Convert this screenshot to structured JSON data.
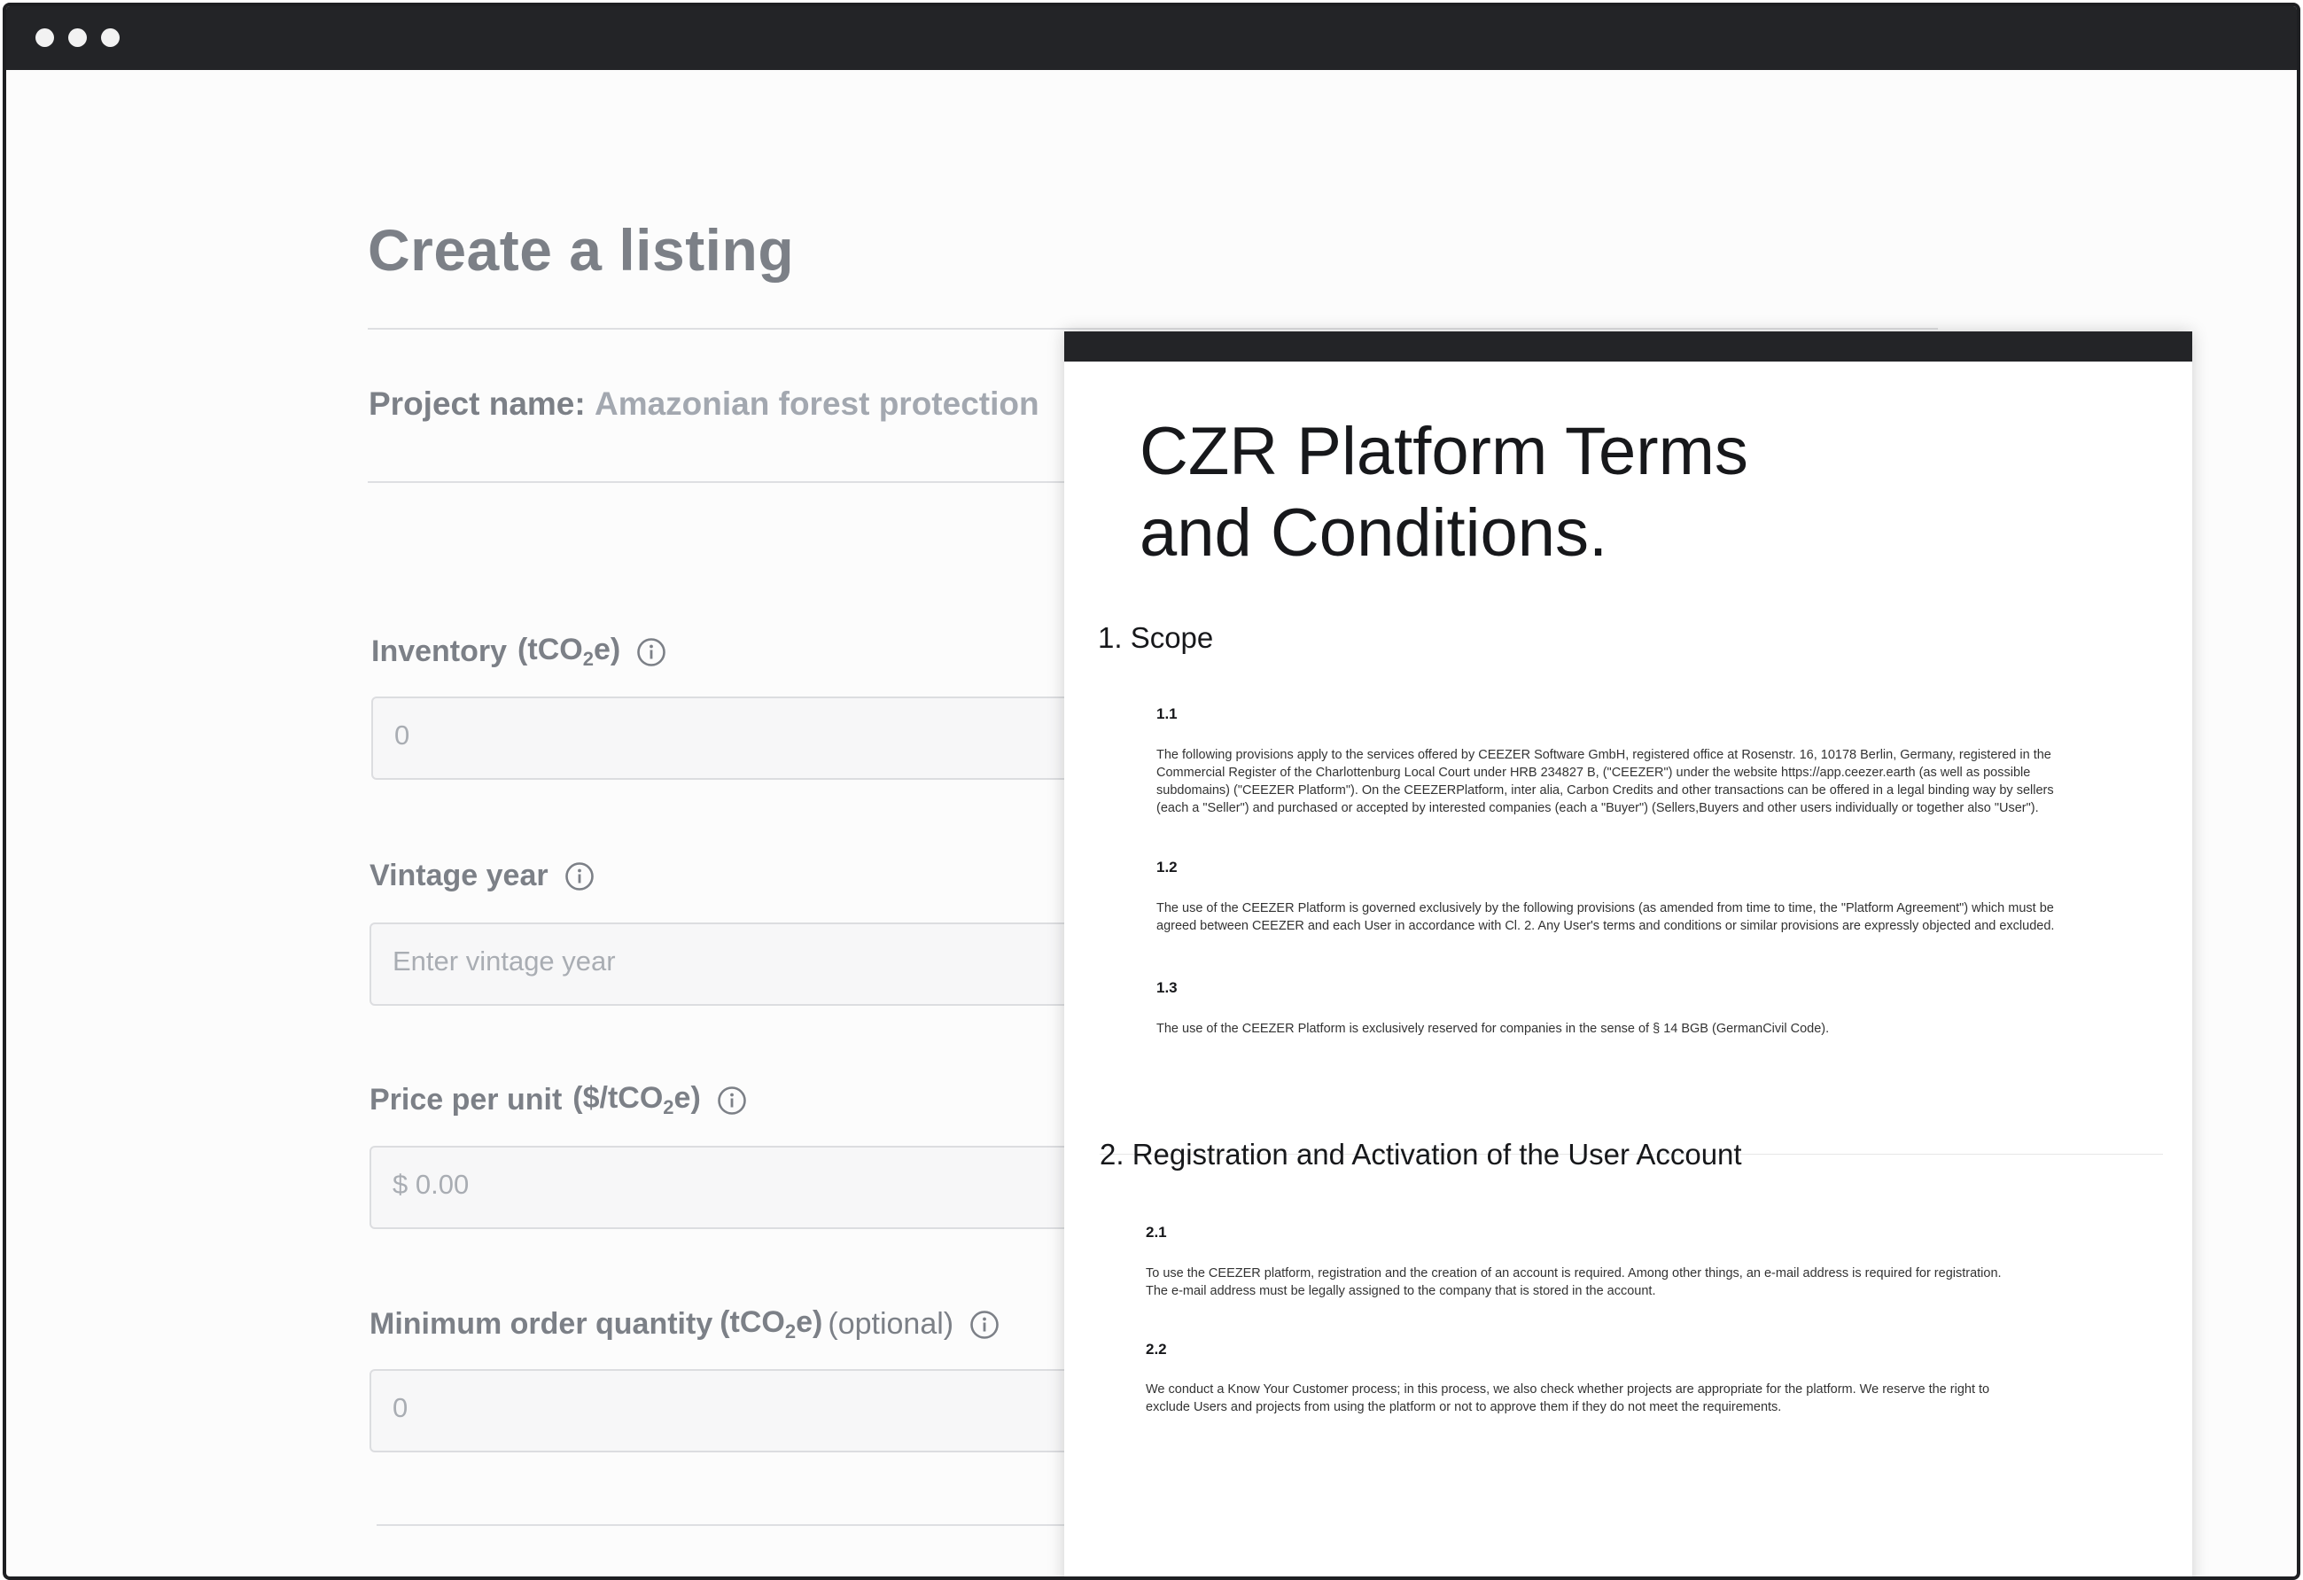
{
  "page": {
    "title": "Create a listing"
  },
  "project": {
    "label": "Project name:",
    "value": "Amazonian forest protection"
  },
  "fields": {
    "inventory": {
      "label": "Inventory",
      "unit_prefix": "(tCO",
      "unit_sub": "2",
      "unit_suffix": "e)",
      "placeholder": "0"
    },
    "vintage_year": {
      "label": "Vintage year",
      "placeholder": "Enter vintage year"
    },
    "price_per_unit": {
      "label": "Price per unit",
      "unit_prefix": "($/tCO",
      "unit_sub": "2",
      "unit_suffix": "e)",
      "placeholder": "$ 0.00"
    },
    "min_order": {
      "label": "Minimum order quantity",
      "unit_prefix": "(tCO",
      "unit_sub": "2",
      "unit_suffix": "e)",
      "optional": "(optional)",
      "placeholder": "0"
    }
  },
  "terms": {
    "title_line1": "CZR Platform Terms",
    "title_line2": "and Conditions.",
    "sections": [
      {
        "heading": "1. Scope",
        "items": [
          {
            "num": "1.1",
            "lines": [
              "The following provisions apply to the services offered by CEEZER Software GmbH, registered office at Rosenstr. 16, 10178 Berlin, Germany, registered in the",
              "Commercial Register of the Charlottenburg Local Court under HRB 234827 B, (\"CEEZER\") under the website https://app.ceezer.earth (as well as possible",
              "subdomains) (\"CEEZER Platform\"). On the CEEZERPlatform, inter alia, Carbon Credits and other transactions can be offered in a legal binding way by sellers",
              "(each a \"Seller\") and purchased or accepted by interested companies (each a \"Buyer\") (Sellers,Buyers and other users individually or together also \"User\")."
            ]
          },
          {
            "num": "1.2",
            "lines": [
              "The use of the CEEZER Platform is governed exclusively by the following provisions (as amended from time to time, the \"Platform Agreement\") which must be",
              "agreed between CEEZER and each User in accordance with Cl. 2. Any User's terms and conditions or similar provisions are expressly objected and excluded."
            ]
          },
          {
            "num": "1.3",
            "lines": [
              "The use of the CEEZER Platform is exclusively reserved for companies in the sense of § 14 BGB (GermanCivil Code)."
            ]
          }
        ]
      },
      {
        "heading": "2. Registration and Activation of the User Account",
        "items": [
          {
            "num": "2.1",
            "lines": [
              "To use the CEEZER platform, registration and the creation of an account is required. Among other things, an e-mail address is required for registration.",
              "The e-mail address must be legally assigned to the company that is stored in the account."
            ]
          },
          {
            "num": "2.2",
            "lines": [
              "We conduct a Know Your Customer process; in this process, we also check whether projects are appropriate for the platform. We reserve the right to",
              "exclude Users and projects from using the platform or not to approve them if they do not meet the requirements."
            ]
          }
        ]
      }
    ]
  }
}
